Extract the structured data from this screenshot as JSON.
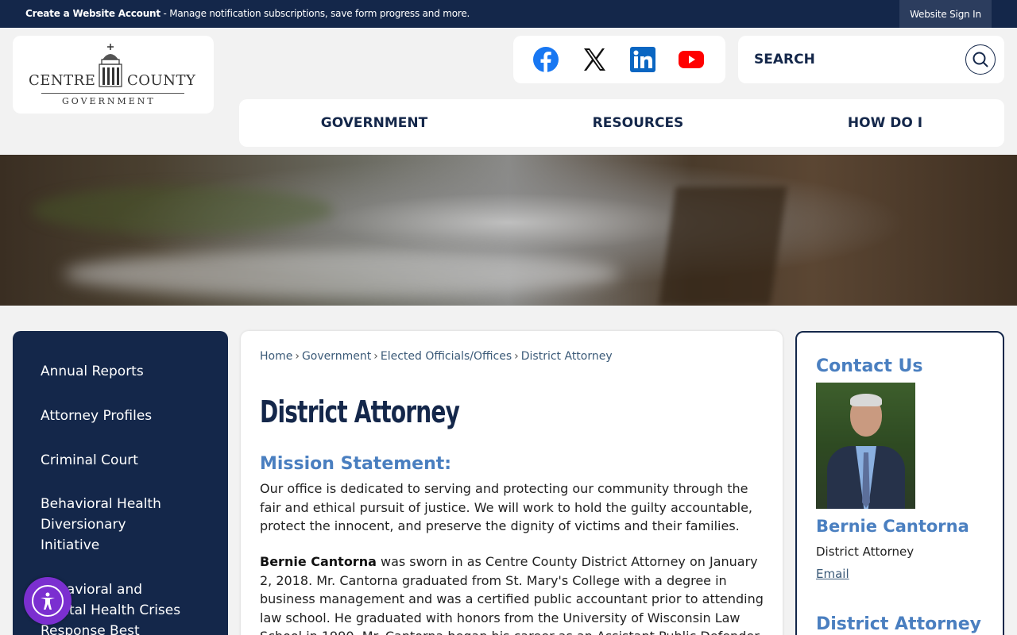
{
  "topbar": {
    "create_account": "Create a Website Account",
    "message": " - Manage notification subscriptions, save form progress and more.",
    "sign_in": "Website Sign In"
  },
  "logo": {
    "line1": "CENTRE",
    "line2": "COUNTY",
    "line3": "GOVERNMENT"
  },
  "social": {
    "icons": [
      "facebook-icon",
      "x-icon",
      "linkedin-icon",
      "youtube-icon"
    ]
  },
  "search": {
    "placeholder": "SEARCH"
  },
  "nav": {
    "items": [
      "GOVERNMENT",
      "RESOURCES",
      "HOW DO I"
    ]
  },
  "sidebar": {
    "items": [
      "Annual Reports",
      "Attorney Profiles",
      "Criminal Court",
      "Behavioral Health Diversionary Initiative",
      "Behavioral and Mental Health Crises Response Best"
    ]
  },
  "breadcrumb": {
    "items": [
      "Home",
      "Government",
      "Elected Officials/Offices",
      "District Attorney"
    ]
  },
  "page": {
    "title": "District Attorney",
    "mission_heading": "Mission Statement:",
    "mission_text": "Our office is dedicated to serving and protecting our community through the fair and ethical pursuit of justice. We will work to hold the guilty accountable, protect the innocent, and preserve the dignity of victims and their families.",
    "bio_name": "Bernie Cantorna",
    "bio_text": " was sworn in as Centre County District Attorney on January 2, 2018. Mr. Cantorna graduated from St. Mary's College with a degree in business management and was a certified public accountant prior to attending law school. He graduated with honors from the University of Wisconsin Law School in 1990. Mr. Cantorna began his career as an Assistant Public Defender and"
  },
  "contact": {
    "heading": "Contact Us",
    "name": "Bernie Cantorna",
    "role": "District Attorney",
    "email_label": "Email",
    "sub_heading": "District Attorney"
  },
  "colors": {
    "navy": "#14274a",
    "accent_blue": "#4a7fc0",
    "a11y_purple": "#7b2fd0"
  }
}
